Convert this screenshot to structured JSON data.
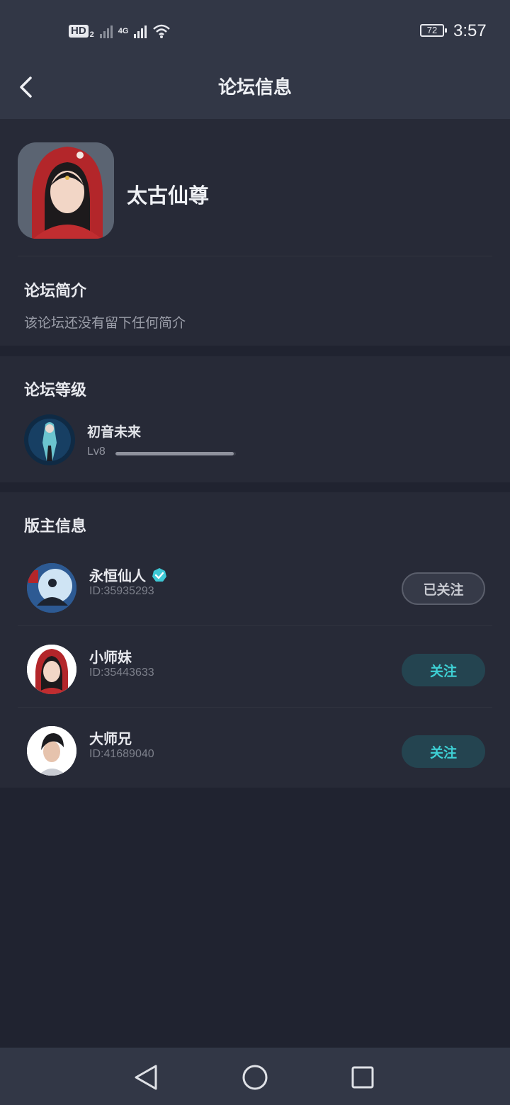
{
  "status_bar": {
    "hd_label": "HD",
    "hd_sub": "2",
    "network_label": "4G",
    "battery": "72",
    "time": "3:57"
  },
  "header": {
    "title": "论坛信息",
    "back_icon": "chevron-left-icon"
  },
  "forum": {
    "name": "太古仙尊"
  },
  "intro": {
    "title": "论坛简介",
    "text": "该论坛还没有留下任何简介"
  },
  "level": {
    "title": "论坛等级",
    "user_name": "初音未来",
    "level_label": "Lv8",
    "progress": 0.98
  },
  "moderators": {
    "title": "版主信息",
    "items": [
      {
        "name": "永恒仙人",
        "id": "ID:35935293",
        "verified": true,
        "button": "已关注",
        "followed": true
      },
      {
        "name": "小师妹",
        "id": "ID:35443633",
        "verified": false,
        "button": "关注",
        "followed": false
      },
      {
        "name": "大师兄",
        "id": "ID:41689040",
        "verified": false,
        "button": "关注",
        "followed": false
      }
    ]
  },
  "nav_bar": {
    "icons": [
      "back-triangle-icon",
      "home-circle-icon",
      "recents-square-icon"
    ]
  },
  "colors": {
    "background": "#202330",
    "card": "#272a37",
    "header": "#323746",
    "accent": "#3ed0d4",
    "follow_button_bg": "#244450"
  }
}
